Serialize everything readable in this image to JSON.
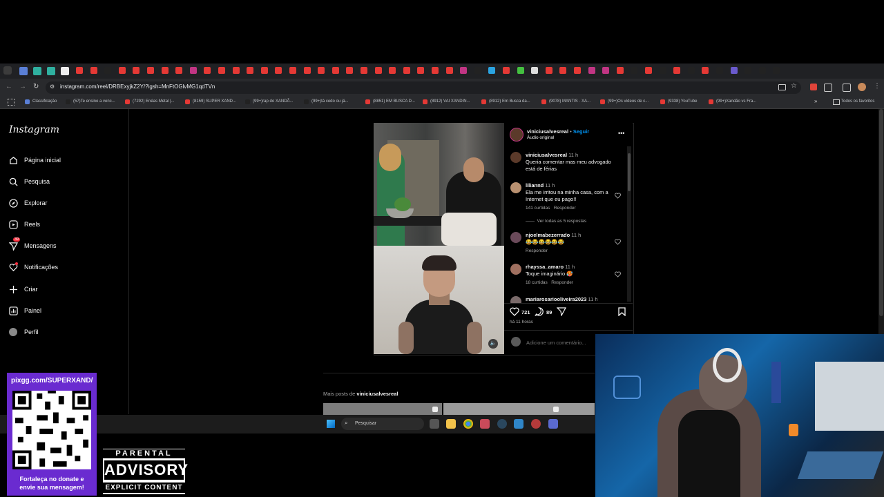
{
  "browser": {
    "url": "instagram.com/reel/DRBExyjkZ2Y/?igsh=MnFtOGlvMG1qdTVn",
    "bookmarks": [
      "Classificação",
      "(57)Te ensino a venc...",
      "(7292) Enéas Metal |...",
      "(8159) SUPER XAND...",
      "(99+)rap do XANDÃ...",
      "(99+)tá cedo ou já...",
      "(8851) EM BUSCA D...",
      "(8912) VAI XANDIN...",
      "(8912) Em Busca da...",
      "(9078) MANTIS · XA...",
      "(99+)Os vídeos de c...",
      "(9338) YouTube",
      "(99+)Xandão vs Fra..."
    ],
    "all_bookmarks": "Todos os favoritos"
  },
  "instagram": {
    "logo": "Instagram",
    "nav": [
      {
        "label": "Página inicial",
        "icon": "home-icon"
      },
      {
        "label": "Pesquisa",
        "icon": "search-icon"
      },
      {
        "label": "Explorar",
        "icon": "compass-icon"
      },
      {
        "label": "Reels",
        "icon": "reels-icon"
      },
      {
        "label": "Mensagens",
        "icon": "messenger-icon",
        "badge": "39"
      },
      {
        "label": "Notificações",
        "icon": "heart-icon"
      },
      {
        "label": "Criar",
        "icon": "plus-icon"
      },
      {
        "label": "Painel",
        "icon": "dashboard-icon"
      },
      {
        "label": "Perfil",
        "icon": "profile-icon"
      }
    ]
  },
  "post": {
    "username": "viniciusalvesreal",
    "follow": "Seguir",
    "audio": "Áudio original",
    "comments": [
      {
        "user": "viniciusalvesreal",
        "time": "11 h",
        "text": "Queria comentar mas meu advogado está de férias",
        "likes": "",
        "reply": ""
      },
      {
        "user": "liliannd",
        "time": "11 h",
        "text": "Ela me irritou na minha casa, com a Internet que eu pago!!",
        "likes": "141 curtidas",
        "reply": "Responder",
        "more": "Ver todas as 5 respostas"
      },
      {
        "user": "njoelmabezerrado",
        "time": "11 h",
        "text": "😂😂😂😂😂😂",
        "likes": "",
        "reply": "Responder"
      },
      {
        "user": "rhayssa_amaro",
        "time": "11 h",
        "text": "Toque imaginário 🥵",
        "likes": "18 curtidas",
        "reply": "Responder"
      },
      {
        "user": "mariarosariooliveira2023",
        "time": "11 h",
        "text": "",
        "likes": "",
        "reply": ""
      }
    ],
    "like_count": "721",
    "comment_count": "89",
    "posted": "há 11 horas",
    "add_comment_placeholder": "Adicione um comentário..."
  },
  "more_posts": {
    "prefix": "Mais posts de",
    "user": "viniciusalvesreal"
  },
  "taskbar": {
    "search": "Pesquisar"
  },
  "overlays": {
    "qr_url": "pixgg.com/SUPERXAND/",
    "qr_caption": "Fortaleça no donate e envie sua mensagem!",
    "advisory_top": "PARENTAL",
    "advisory_mid": "ADVISORY",
    "advisory_bottom": "EXPLICIT CONTENT"
  },
  "colors": {
    "accent_blue": "#0095f6",
    "notification_red": "#ff3040",
    "pix_purple": "#6a2bd0"
  }
}
